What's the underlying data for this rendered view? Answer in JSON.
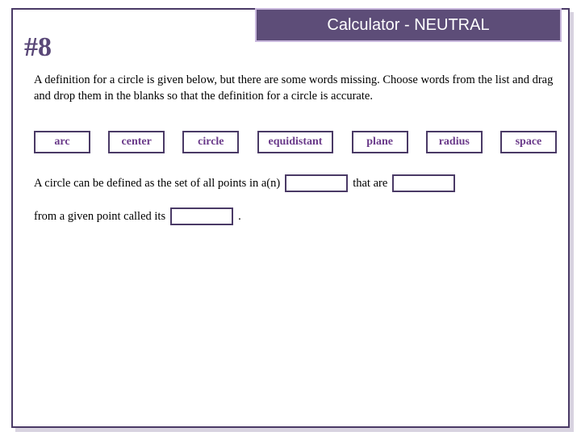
{
  "header": {
    "calc_label": "Calculator - NEUTRAL",
    "question_number": "#8"
  },
  "instructions": "A definition for a circle is given below, but there are some words missing. Choose words from the list and drag and drop them in the blanks so that the definition for a circle is accurate.",
  "word_bank": [
    "arc",
    "center",
    "circle",
    "equidistant",
    "plane",
    "radius",
    "space"
  ],
  "sentence": {
    "part1": "A circle can be defined as the set of all points in a(n)",
    "part2": "that are",
    "part3": "from a given point called its",
    "part4": "."
  }
}
